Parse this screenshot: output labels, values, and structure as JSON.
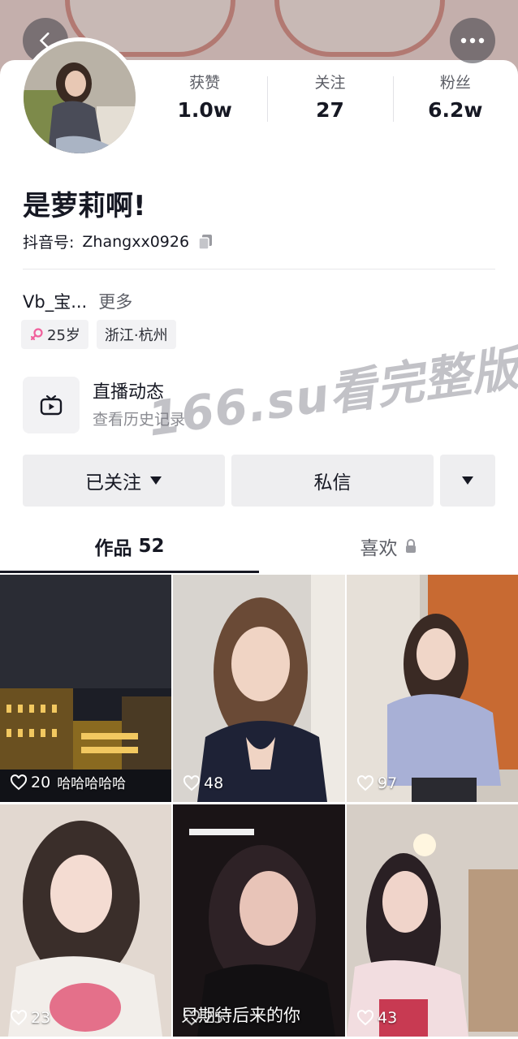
{
  "profile": {
    "nickname": "是萝莉啊!",
    "douyin_id_label": "抖音号:",
    "douyin_id": "Zhangxx0926",
    "stats": [
      {
        "label": "获赞",
        "value": "1.0w"
      },
      {
        "label": "关注",
        "value": "27"
      },
      {
        "label": "粉丝",
        "value": "6.2w"
      }
    ],
    "bio": "Vb_宝...",
    "bio_more": "更多",
    "tags": {
      "age": "25岁",
      "location": "浙江·杭州"
    }
  },
  "live": {
    "title": "直播动态",
    "subtitle": "查看历史记录"
  },
  "actions": {
    "follow": "已关注",
    "message": "私信"
  },
  "watermark": "166.su看完整版",
  "tabs": {
    "works_label": "作品",
    "works_count": "52",
    "likes_label": "喜欢"
  },
  "videos": [
    {
      "likes": "20",
      "caption": "哈哈哈哈哈"
    },
    {
      "likes": "48"
    },
    {
      "likes": "97"
    },
    {
      "likes": "23"
    },
    {
      "likes": "25",
      "caption": "只期待后来的你"
    },
    {
      "likes": "43"
    }
  ],
  "icons": {
    "back": "chevron-left-icon",
    "more": "more-icon",
    "copy": "copy-icon",
    "female": "female-icon",
    "live": "live-tv-icon",
    "dropdown": "caret-down-icon",
    "lock": "lock-icon",
    "heart": "heart-icon"
  },
  "colors": {
    "female": "#f0609c",
    "text": "#161823",
    "button_bg": "#eeeef0"
  }
}
